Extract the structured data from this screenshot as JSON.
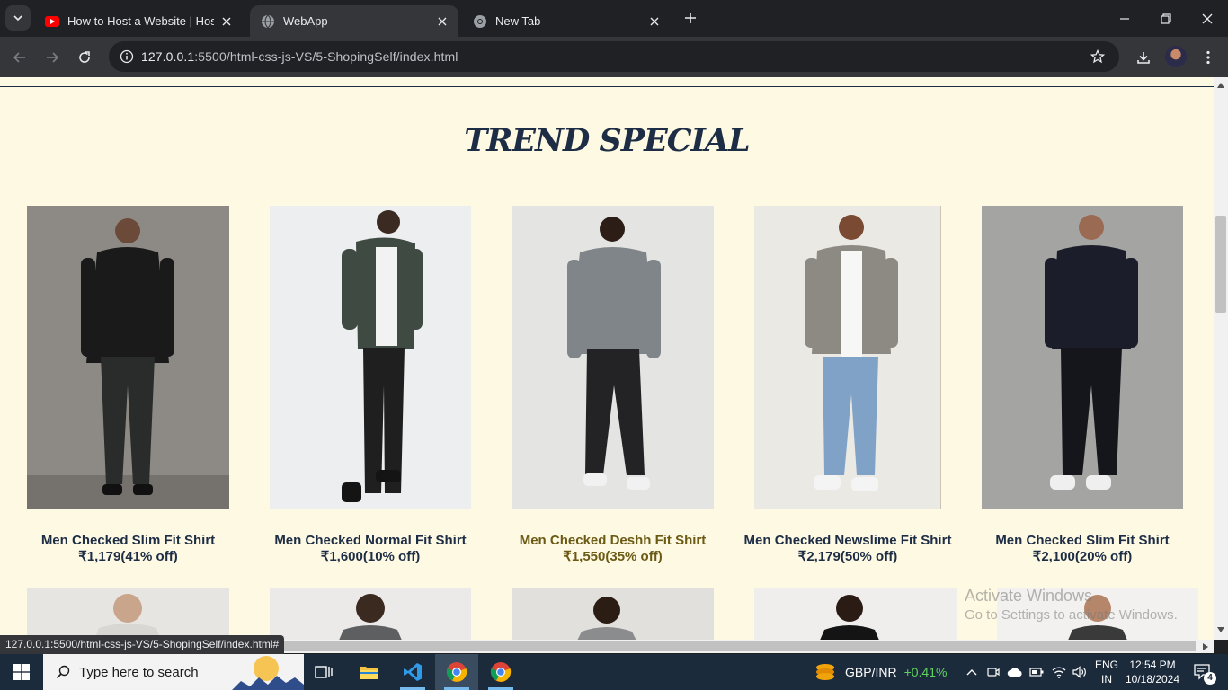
{
  "browser": {
    "tabs": [
      {
        "title": "How to Host a Website | Hostin",
        "favicon": "youtube-icon",
        "active": false
      },
      {
        "title": "WebApp",
        "favicon": "globe-icon",
        "active": true
      },
      {
        "title": "New Tab",
        "favicon": "chrome-icon",
        "active": false
      }
    ],
    "address": {
      "host": "127.0.0.1",
      "path": ":5500/html-css-js-VS/5-ShopingSelf/index.html"
    },
    "status_url": "127.0.0.1:5500/html-css-js-VS/5-ShopingSelf/index.html#"
  },
  "page": {
    "section_title": "TREND SPECIAL",
    "products": [
      {
        "name": "Men Checked Slim Fit Shirt",
        "price": "₹1,179(41% off)",
        "bg": "#8d8a86",
        "fg": "#1a1a1a",
        "highlighted": false
      },
      {
        "name": "Men Checked Normal Fit Shirt",
        "price": "₹1,600(10% off)",
        "bg": "#eceef0",
        "fg": "#2f3a34",
        "highlighted": false
      },
      {
        "name": "Men Checked Deshh Fit Shirt",
        "price": "₹1,550(35% off)",
        "bg": "#e4e4e2",
        "fg": "#7f8589",
        "highlighted": true
      },
      {
        "name": "Men Checked Newslime Fit Shirt",
        "price": "₹2,179(50% off)",
        "bg": "#ebe9e4",
        "fg": "#8d8a84",
        "highlighted": false
      },
      {
        "name": "Men Checked Slim Fit Shirt",
        "price": "₹2,100(20% off)",
        "bg": "#a4a4a2",
        "fg": "#1b1e2a",
        "highlighted": false
      }
    ],
    "row2_colors": [
      "#e7e5e2",
      "#eceae8",
      "#e1e0dc",
      "#efeeec",
      "#f2f1ef"
    ]
  },
  "watermark": {
    "line1": "Activate Windows",
    "line2": "Go to Settings to activate Windows."
  },
  "taskbar": {
    "search_placeholder": "Type here to search",
    "ticker_symbol": "GBP/INR",
    "ticker_change": "+0.41%",
    "lang_top": "ENG",
    "lang_bottom": "IN",
    "time": "12:54 PM",
    "date": "10/18/2024",
    "notifications": "4"
  }
}
